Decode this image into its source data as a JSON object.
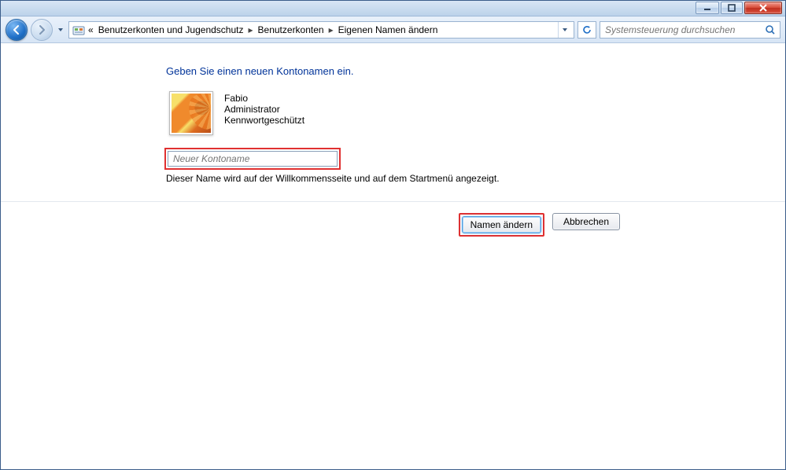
{
  "window_buttons": {
    "minimize": "minimize",
    "maximize": "maximize",
    "close": "close"
  },
  "breadcrumb": {
    "prefix": "«",
    "items": [
      "Benutzerkonten und Jugendschutz",
      "Benutzerkonten",
      "Eigenen Namen ändern"
    ]
  },
  "search": {
    "placeholder": "Systemsteuerung durchsuchen"
  },
  "heading": "Geben Sie einen neuen Kontonamen ein.",
  "user": {
    "name": "Fabio",
    "role": "Administrator",
    "status": "Kennwortgeschützt"
  },
  "input": {
    "placeholder": "Neuer Kontoname",
    "value": ""
  },
  "help_text": "Dieser Name wird auf der Willkommensseite und auf dem Startmenü angezeigt.",
  "buttons": {
    "confirm": "Namen ändern",
    "cancel": "Abbrechen"
  }
}
